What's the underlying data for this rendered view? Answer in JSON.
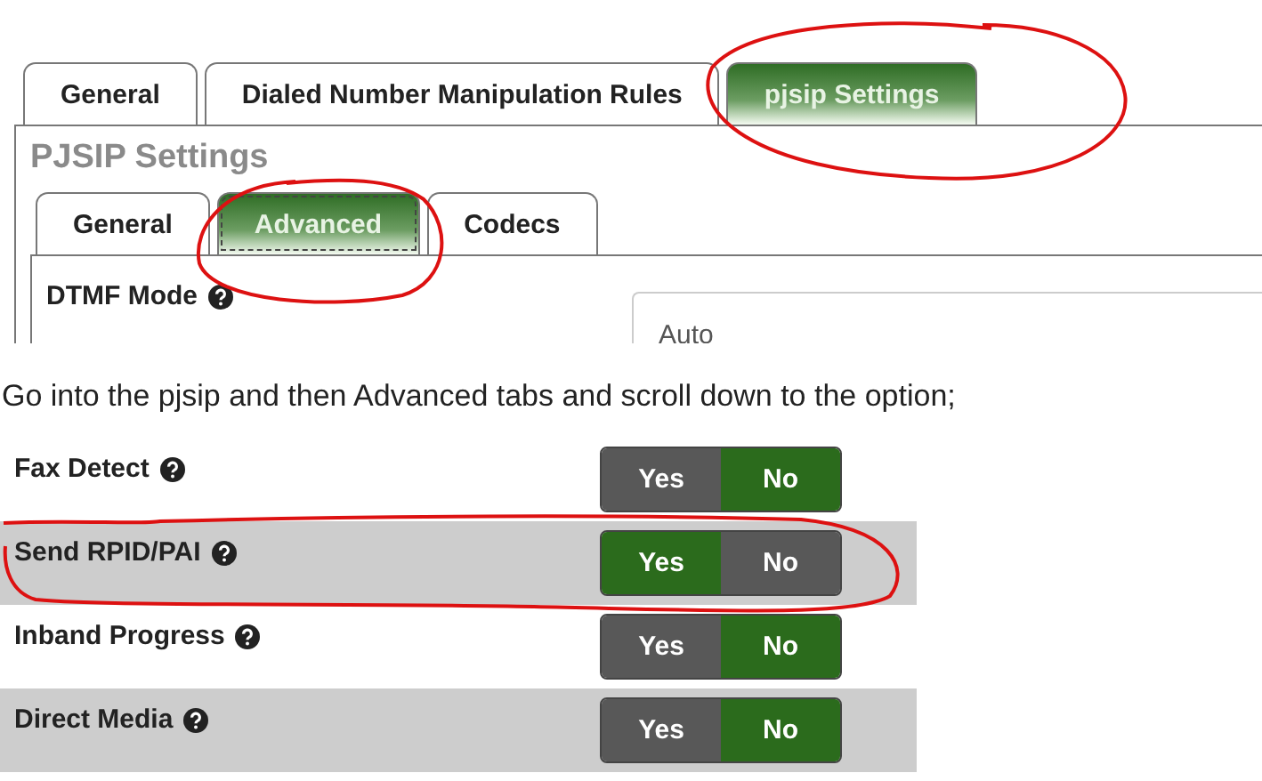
{
  "tabs": [
    {
      "label": "General",
      "selected": false
    },
    {
      "label": "Dialed Number Manipulation Rules",
      "selected": false
    },
    {
      "label": "pjsip Settings",
      "selected": true
    }
  ],
  "section_title": "PJSIP Settings",
  "sub_tabs": [
    {
      "label": "General",
      "selected": false
    },
    {
      "label": "Advanced",
      "selected": true
    },
    {
      "label": "Codecs",
      "selected": false
    }
  ],
  "dtmf_field": {
    "label": "DTMF Mode",
    "value": "Auto"
  },
  "instruction": "Go into the pjsip and then Advanced tabs and scroll down to the option;",
  "options": [
    {
      "label": "Fax Detect",
      "shaded": false,
      "choices": [
        {
          "label": "Yes",
          "selected": false
        },
        {
          "label": "No",
          "selected": true
        }
      ]
    },
    {
      "label": "Send RPID/PAI",
      "shaded": true,
      "choices": [
        {
          "label": "Yes",
          "selected": true
        },
        {
          "label": "No",
          "selected": false
        }
      ]
    },
    {
      "label": "Inband Progress",
      "shaded": false,
      "choices": [
        {
          "label": "Yes",
          "selected": false
        },
        {
          "label": "No",
          "selected": true
        }
      ]
    },
    {
      "label": "Direct Media",
      "shaded": true,
      "choices": [
        {
          "label": "Yes",
          "selected": false
        },
        {
          "label": "No",
          "selected": true
        }
      ]
    }
  ]
}
